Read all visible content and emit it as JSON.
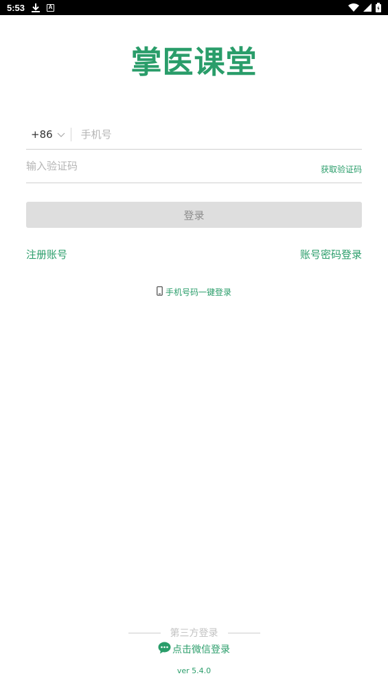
{
  "status_bar": {
    "time": "5:53",
    "icons": [
      "download-icon",
      "a-icon",
      "wifi-icon",
      "signal-icon",
      "battery-icon"
    ]
  },
  "app": {
    "title": "掌医课堂",
    "brand_color": "#2a9d6a"
  },
  "login_form": {
    "country_code": "+86",
    "phone_placeholder": "手机号",
    "code_placeholder": "输入验证码",
    "get_code_label": "获取验证码",
    "login_label": "登录"
  },
  "links": {
    "register": "注册账号",
    "password_login": "账号密码登录",
    "one_key_login": "手机号码一键登录"
  },
  "third_party": {
    "heading": "第三方登录",
    "wechat_label": "点击微信登录"
  },
  "version": "ver 5.4.0"
}
